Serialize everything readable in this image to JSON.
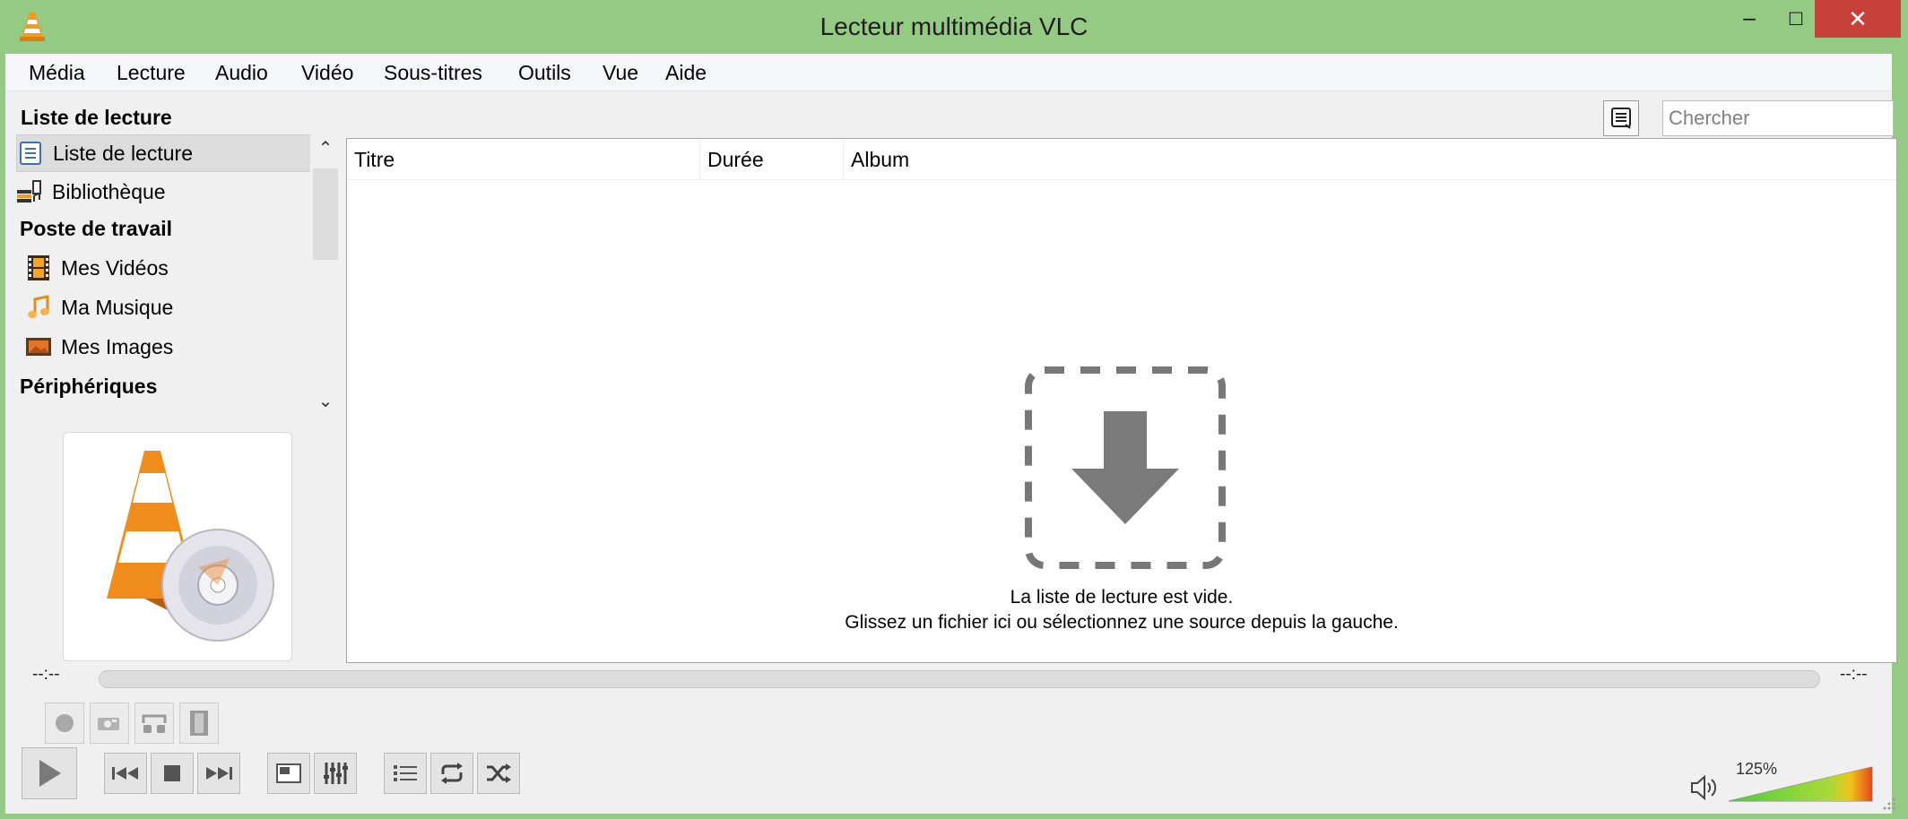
{
  "window": {
    "title": "Lecteur multimédia VLC",
    "minimize": "–",
    "maximize": "□",
    "close": "✕"
  },
  "menu": [
    "Média",
    "Lecture",
    "Audio",
    "Vidéo",
    "Sous-titres",
    "Outils",
    "Vue",
    "Aide"
  ],
  "sidebar": {
    "title": "Liste de lecture",
    "items": [
      {
        "label": "Liste de lecture",
        "icon": "playlist-icon",
        "selected": true
      },
      {
        "label": "Bibliothèque",
        "icon": "library-icon"
      }
    ],
    "sections": [
      {
        "heading": "Poste de travail",
        "items": [
          {
            "label": "Mes Vidéos",
            "icon": "film-icon"
          },
          {
            "label": "Ma Musique",
            "icon": "music-note-icon"
          },
          {
            "label": "Mes Images",
            "icon": "picture-icon"
          }
        ]
      },
      {
        "heading": "Périphériques",
        "items": []
      }
    ]
  },
  "search": {
    "placeholder": "Chercher"
  },
  "playlist": {
    "columns": [
      "Titre",
      "Durée",
      "Album"
    ],
    "empty_line1": "La liste de lecture est vide.",
    "empty_line2": "Glissez un fichier ici ou sélectionnez une source depuis la gauche."
  },
  "seek": {
    "elapsed": "--:--",
    "remaining": "--:--"
  },
  "volume": {
    "level_percent": 125,
    "label": "125%"
  },
  "colors": {
    "titlebar": "#95ca84",
    "close": "#c7403a",
    "accent_orange": "#f29b1d"
  }
}
